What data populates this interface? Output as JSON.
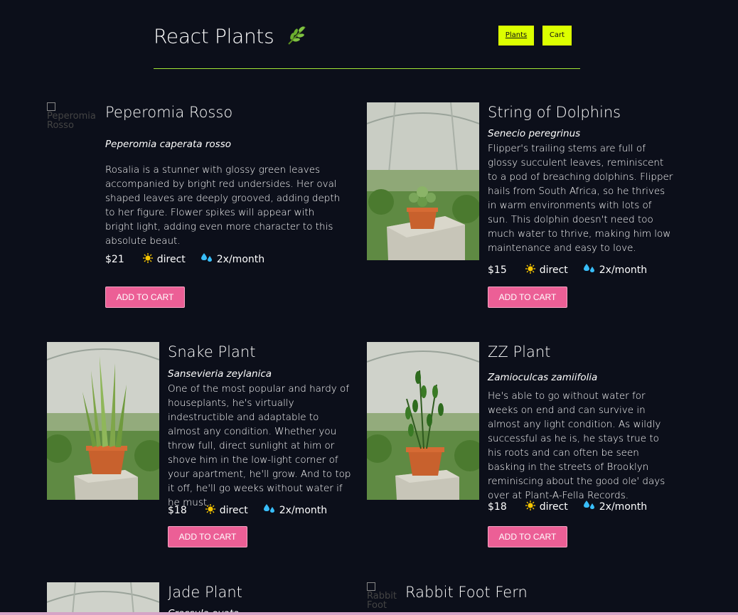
{
  "header": {
    "title": "React Plants",
    "nav": {
      "plants": "Plants",
      "cart": "Cart"
    },
    "accent_color": "#dcff00",
    "divider_color": "#a3e635"
  },
  "plants": [
    {
      "name": "Peperomia Rosso",
      "scientific": "Peperomia caperata rosso",
      "description": "Rosalia is a stunner with glossy green leaves accompanied by bright red undersides. Her oval shaped leaves are deeply grooved, adding depth to her figure. Flower spikes will appear with bright light, adding even more character to this absolute beaut.",
      "price": "$21",
      "light": "direct",
      "water": "2x/month",
      "image_alt": "Peperomia Rosso",
      "button": "ADD TO CART"
    },
    {
      "name": "String of Dolphins",
      "scientific": "Senecio peregrinus",
      "description": "Flipper's trailing stems are full of glossy succulent leaves, reminiscent to a pod of breaching dolphins. Flipper hails from South Africa, so he thrives in warm environments with lots of sun. This dolphin doesn't need too much water to thrive, making him low maintenance and easy to love.",
      "price": "$15",
      "light": "direct",
      "water": "2x/month",
      "button": "ADD TO CART"
    },
    {
      "name": "Snake Plant",
      "scientific": "Sansevieria zeylanica",
      "description": "One of the most popular and hardy of houseplants, he's virtually indestructible and adaptable to almost any condition. Whether you throw full, direct sunlight at him or shove him in the low-light corner of your apartment, he'll grow. And to top it off, he'll go weeks without water if he must.",
      "price": "$18",
      "light": "direct",
      "water": "2x/month",
      "button": "ADD TO CART"
    },
    {
      "name": "ZZ Plant",
      "scientific": "Zamioculcas zamiifolia",
      "description": "He's able to go without water for weeks on end and can survive in almost any light condition. As wildly successful as he is, he stays true to his roots and can often be seen basking in the streets of Brooklyn reminiscing about the good ole' days over at Plant-A-Fella Records.",
      "price": "$18",
      "light": "direct",
      "water": "2x/month",
      "button": "ADD TO CART"
    },
    {
      "name": "Jade Plant",
      "scientific": "Crassula ovata"
    },
    {
      "name": "Rabbit Foot Fern",
      "image_alt": "Rabbit Foot"
    }
  ],
  "colors": {
    "button": "#ec5f96",
    "background": "#0c0f1a",
    "sun_icon": "#f7c600",
    "drop_icon": "#38bdf8"
  },
  "icons": {
    "logo": "herb-leaf-icon",
    "light": "sun-icon",
    "water": "water-drops-icon"
  }
}
